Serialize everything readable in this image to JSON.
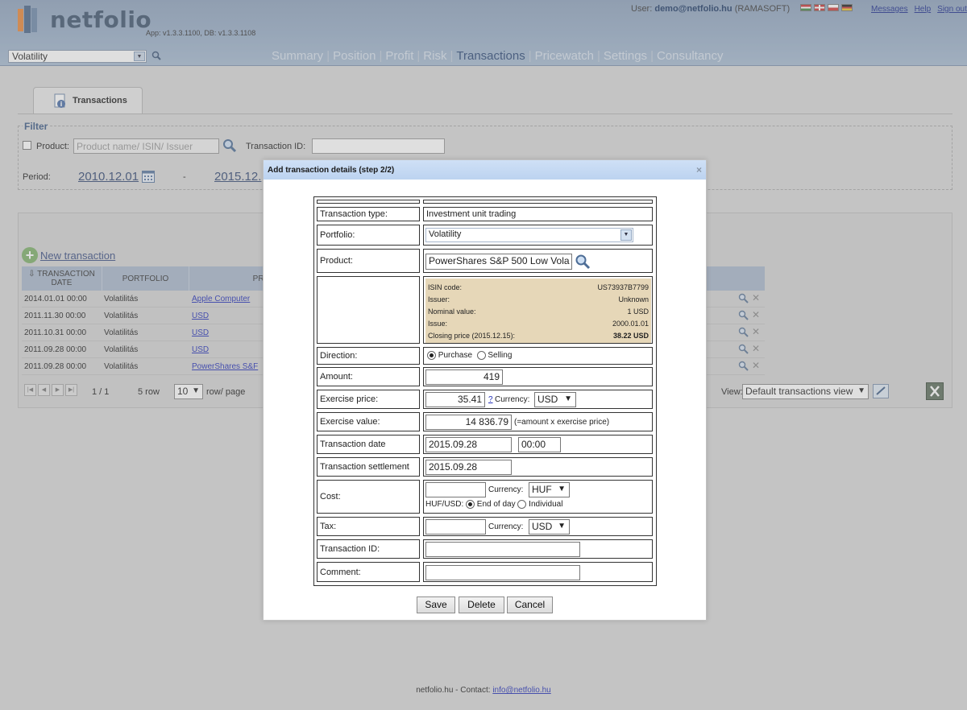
{
  "header": {
    "brand": "netfolio",
    "app_version": "App: v1.3.3.1100, DB: v1.3.3.1108",
    "user_prefix": "User: ",
    "user_email": "demo@netfolio.hu",
    "user_company": "(RAMASOFT)",
    "links": [
      "Messages",
      "Help",
      "Sign out"
    ],
    "portfolio_selected": "Volatility",
    "nav": [
      "Summary",
      "Position",
      "Profit",
      "Risk",
      "Transactions",
      "Pricewatch",
      "Settings",
      "Consultancy"
    ],
    "nav_active": "Transactions"
  },
  "tab": {
    "label": "Transactions"
  },
  "filter": {
    "legend": "Filter",
    "product_label": "Product:",
    "product_placeholder": "Product name/ ISIN/ Issuer",
    "transaction_id_label": "Transaction ID:",
    "transaction_id_value": "",
    "period_label": "Period:",
    "period_from": "2010.12.01",
    "period_dash": "-",
    "period_to": "2015.12."
  },
  "table": {
    "new_transaction": "New transaction",
    "headers": {
      "date": "TRANSACTION DATE",
      "date_sort_icon": "⇩",
      "portfolio": "PORTFOLIO",
      "product": "PRO"
    },
    "rows": [
      {
        "date": "2014.01.01 00:00",
        "portfolio": "Volatilitás",
        "product": "Apple Computer"
      },
      {
        "date": "2011.11.30 00:00",
        "portfolio": "Volatilitás",
        "product": "USD"
      },
      {
        "date": "2011.10.31 00:00",
        "portfolio": "Volatilitás",
        "product": "USD"
      },
      {
        "date": "2011.09.28 00:00",
        "portfolio": "Volatilitás",
        "product": "USD"
      },
      {
        "date": "2011.09.28 00:00",
        "portfolio": "Volatilitás",
        "product": "PowerShares S&F"
      }
    ],
    "pager": {
      "page": "1 / 1",
      "rows": "5 row",
      "per_page": "10",
      "per_page_label": "row/ page"
    },
    "view_label": "View:",
    "view_selected": "Default transactions view"
  },
  "modal": {
    "title": "Add transaction details (step 2/2)",
    "close": "×",
    "labels": {
      "transaction_type": "Transaction type:",
      "portfolio": "Portfolio:",
      "product": "Product:",
      "direction": "Direction:",
      "amount": "Amount:",
      "exercise_price": "Exercise price:",
      "exercise_value": "Exercise value:",
      "transaction_date": "Transaction date",
      "transaction_settlement": "Transaction settlement",
      "cost": "Cost:",
      "tax": "Tax:",
      "transaction_id": "Transaction ID:",
      "comment": "Comment:"
    },
    "values": {
      "transaction_type": "Investment unit trading",
      "portfolio": "Volatility",
      "product": "PowerShares S&P 500 Low Vola",
      "direction_purchase": "Purchase",
      "direction_selling": "Selling",
      "amount": "419",
      "exercise_price": "35.41",
      "help_mark": "?",
      "currency_label": "Currency:",
      "exercise_currency": "USD",
      "exercise_value": "14 836.79",
      "exercise_value_note": "(=amount x exercise price)",
      "transaction_date": "2015.09.28",
      "transaction_time": "00:00",
      "settlement_date": "2015.09.28",
      "cost": "",
      "cost_currency": "HUF",
      "huf_usd_label": "HUF/USD:",
      "end_of_day": "End of day",
      "individual": "Individual",
      "tax": "",
      "tax_currency": "USD",
      "transaction_id": "",
      "comment": ""
    },
    "product_info": [
      {
        "label": "ISIN code:",
        "value": "US73937B7799"
      },
      {
        "label": "Issuer:",
        "value": "Unknown"
      },
      {
        "label": "Nominal value:",
        "value": "1 USD"
      },
      {
        "label": "Issue:",
        "value": "2000.01.01"
      },
      {
        "label": "Closing price (2015.12.15):",
        "value": "38.22 USD"
      }
    ],
    "buttons": {
      "save": "Save",
      "delete": "Delete",
      "cancel": "Cancel"
    }
  },
  "footer": {
    "text": "netfolio.hu - Contact: ",
    "email": "info@netfolio.hu"
  },
  "colors": {
    "header_bg": "#9bb0c9",
    "nav_active": "#2d4a78",
    "modal_header": "#c4d8f2",
    "info_box": "#e6d7b8",
    "link": "#2431b8"
  }
}
